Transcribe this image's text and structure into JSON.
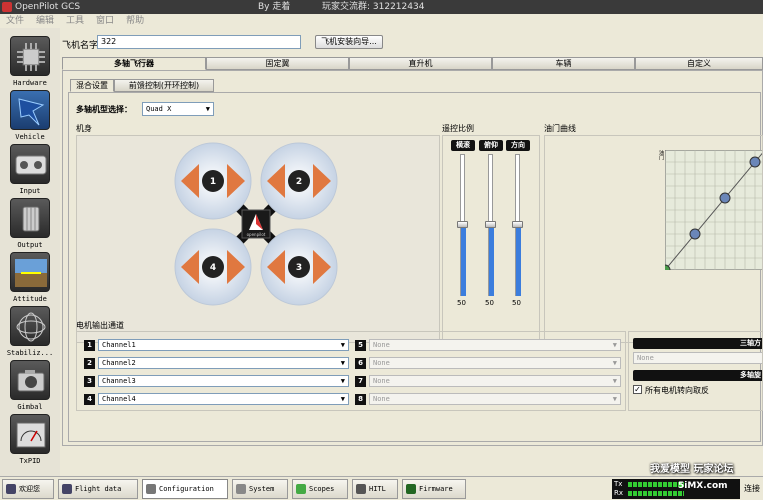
{
  "window": {
    "title": "OpenPilot GCS",
    "by": "By 走着",
    "qq": "玩家交流群: 312212434"
  },
  "menu": [
    "文件",
    "编辑",
    "工具",
    "窗口",
    "帮助"
  ],
  "sidebar": [
    {
      "label": "Hardware",
      "icon": "chip-icon"
    },
    {
      "label": "Vehicle",
      "icon": "airplane-icon"
    },
    {
      "label": "Input",
      "icon": "gamepad-icon"
    },
    {
      "label": "Output",
      "icon": "motor-icon"
    },
    {
      "label": "Attitude",
      "icon": "horizon-icon"
    },
    {
      "label": "Stabiliz...",
      "icon": "gyro-icon"
    },
    {
      "label": "Gimbal",
      "icon": "camera-icon"
    },
    {
      "label": "TxPID",
      "icon": "meter-icon"
    }
  ],
  "airframe": {
    "name_label": "飞机名字",
    "name_value": "322",
    "wizard_button": "飞机安装向导..."
  },
  "tabs": [
    "多轴飞行器",
    "固定翼",
    "直升机",
    "车辆",
    "自定义"
  ],
  "subtabs": [
    "混合设置",
    "前馈控制(开环控制)"
  ],
  "mix": {
    "type_label": "多轴机型选择：",
    "type_value": "Quad X",
    "frame_label": "机身",
    "ratio_label": "遥控比例",
    "curve_label": "油门曲线",
    "rc": [
      {
        "label": "横滚",
        "value": "50"
      },
      {
        "label": "俯仰",
        "value": "50"
      },
      {
        "label": "方向",
        "value": "50"
      }
    ],
    "rc_levels": [
      0.5,
      0.5,
      0.5
    ],
    "motors": [
      "1",
      "2",
      "3",
      "4"
    ],
    "logo_text": "openpilot",
    "curve_axis": "油门"
  },
  "motor_channels": {
    "label": "电机输出通道",
    "left": [
      {
        "num": "1",
        "value": "Channel1"
      },
      {
        "num": "2",
        "value": "Channel2"
      },
      {
        "num": "3",
        "value": "Channel3"
      },
      {
        "num": "4",
        "value": "Channel4"
      }
    ],
    "right": [
      {
        "num": "5",
        "value": "None"
      },
      {
        "num": "6",
        "value": "None"
      },
      {
        "num": "7",
        "value": "None"
      },
      {
        "num": "8",
        "value": "None"
      }
    ]
  },
  "right_panel": {
    "header1": "三轴方",
    "combo": "None",
    "header2": "多轴旋",
    "checkbox_label": "所有电机转向取反"
  },
  "taskbar": [
    {
      "label": "欢迎您",
      "icon": "home-icon"
    },
    {
      "label": "Flight data",
      "icon": "monitor-icon"
    },
    {
      "label": "Configuration",
      "icon": "wrench-icon"
    },
    {
      "label": "System",
      "icon": "gears-icon"
    },
    {
      "label": "Scopes",
      "icon": "scope-icon"
    },
    {
      "label": "HITL",
      "icon": "controller-icon"
    },
    {
      "label": "Firmware",
      "icon": "chip-icon"
    }
  ],
  "status": {
    "tx": "Tx",
    "rx": "Rx",
    "watermark1": "我爱模型 玩家论坛",
    "watermark2": "5iMX.com",
    "connect": "连接"
  }
}
